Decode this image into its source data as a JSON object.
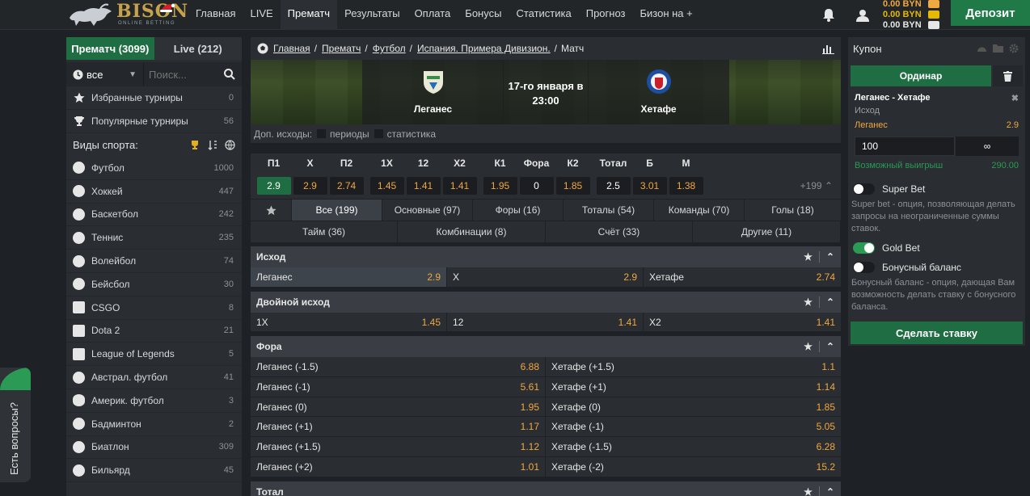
{
  "logo": {
    "word": "BISON",
    "tagline": "ONLINE BETTING"
  },
  "nav": [
    "Главная",
    "LIVE",
    "Прематч",
    "Результаты",
    "Оплата",
    "Бонусы",
    "Статистика",
    "Прогноз",
    "Бизон на +"
  ],
  "nav_active": "Прематч",
  "balances": [
    {
      "amount": "0.00 BYN",
      "color": "#f0a840",
      "icon": "wallet-icon"
    },
    {
      "amount": "0.00 BYN",
      "color": "#e6b800",
      "icon": "bonus-icon"
    },
    {
      "amount": "0.00 BYN",
      "color": "#e6e6e6",
      "icon": "gift-icon"
    }
  ],
  "deposit_label": "Депозит",
  "sidebar": {
    "tab_prematch": "Прематч (3099)",
    "tab_live": "Live (212)",
    "filter_value": "все",
    "search_placeholder": "Поиск...",
    "favorites": {
      "label": "Избранные турниры",
      "count": "0"
    },
    "popular": {
      "label": "Популярные турниры",
      "count": "56"
    },
    "sports_title": "Виды спорта:",
    "sports": [
      {
        "label": "Футбол",
        "count": "1000",
        "icon": "soccer-icon"
      },
      {
        "label": "Хоккей",
        "count": "447",
        "icon": "hockey-icon"
      },
      {
        "label": "Баскетбол",
        "count": "242",
        "icon": "basketball-icon"
      },
      {
        "label": "Теннис",
        "count": "235",
        "icon": "tennis-icon"
      },
      {
        "label": "Волейбол",
        "count": "74",
        "icon": "volleyball-icon"
      },
      {
        "label": "Бейсбол",
        "count": "30",
        "icon": "baseball-icon"
      },
      {
        "label": "CSGO",
        "count": "8",
        "icon": "csgo-icon"
      },
      {
        "label": "Dota 2",
        "count": "21",
        "icon": "dota-icon"
      },
      {
        "label": "League of Legends",
        "count": "5",
        "icon": "lol-icon"
      },
      {
        "label": "Австрал. футбол",
        "count": "41",
        "icon": "aussie-rules-icon"
      },
      {
        "label": "Америк. футбол",
        "count": "3",
        "icon": "american-football-icon"
      },
      {
        "label": "Бадминтон",
        "count": "2",
        "icon": "badminton-icon"
      },
      {
        "label": "Биатлон",
        "count": "309",
        "icon": "biathlon-icon"
      },
      {
        "label": "Бильярд",
        "count": "45",
        "icon": "billiards-icon"
      }
    ]
  },
  "chat_label": "Есть вопросы?",
  "breadcrumb": {
    "items": [
      "Главная",
      "Прематч",
      "Футбол",
      "Испания. Примера Дивизион."
    ],
    "current": "Матч"
  },
  "match": {
    "home": "Леганес",
    "away": "Хетафе",
    "date": "17-го января в",
    "time": "23:00"
  },
  "extra": {
    "label": "Доп. исходы:",
    "opt1": "периоды",
    "opt2": "статистика"
  },
  "quick": {
    "headers": [
      "П1",
      "X",
      "П2",
      "1X",
      "12",
      "X2",
      "К1",
      "Фора",
      "К2",
      "Тотал",
      "Б",
      "М"
    ],
    "values": [
      "2.9",
      "2.9",
      "2.74",
      "1.45",
      "1.41",
      "1.41",
      "1.95",
      "0",
      "1.85",
      "2.5",
      "3.01",
      "1.38"
    ],
    "more": "+199"
  },
  "tabs_row1": [
    "Все (199)",
    "Основные (97)",
    "Форы (16)",
    "Тоталы (54)",
    "Команды (70)",
    "Голы (18)"
  ],
  "tabs_row2": [
    "Тайм (36)",
    "Комбинации (8)",
    "Счёт (33)",
    "Другие (11)"
  ],
  "markets": {
    "outcome": {
      "title": "Исход",
      "cells": [
        {
          "label": "Леганес",
          "odd": "2.9"
        },
        {
          "label": "X",
          "odd": "2.9"
        },
        {
          "label": "Хетафе",
          "odd": "2.74"
        }
      ]
    },
    "double": {
      "title": "Двойной исход",
      "cells": [
        {
          "label": "1X",
          "odd": "1.45"
        },
        {
          "label": "12",
          "odd": "1.41"
        },
        {
          "label": "X2",
          "odd": "1.41"
        }
      ]
    },
    "handicap": {
      "title": "Фора",
      "rows": [
        [
          {
            "label": "Леганес (-1.5)",
            "odd": "6.88"
          },
          {
            "label": "Хетафе (+1.5)",
            "odd": "1.1"
          }
        ],
        [
          {
            "label": "Леганес (-1)",
            "odd": "5.61"
          },
          {
            "label": "Хетафе (+1)",
            "odd": "1.14"
          }
        ],
        [
          {
            "label": "Леганес (0)",
            "odd": "1.95"
          },
          {
            "label": "Хетафе (0)",
            "odd": "1.85"
          }
        ],
        [
          {
            "label": "Леганес (+1)",
            "odd": "1.17"
          },
          {
            "label": "Хетафе (-1)",
            "odd": "5.05"
          }
        ],
        [
          {
            "label": "Леганес (+1.5)",
            "odd": "1.12"
          },
          {
            "label": "Хетафе (-1.5)",
            "odd": "6.28"
          }
        ],
        [
          {
            "label": "Леганес (+2)",
            "odd": "1.01"
          },
          {
            "label": "Хетафе (-2)",
            "odd": "15.2"
          }
        ]
      ]
    },
    "total": {
      "title": "Тотал"
    }
  },
  "coupon": {
    "title": "Купон",
    "type": "Ординар",
    "bet_match": "Леганес - Хетафе",
    "bet_market": "Исход",
    "bet_pick": "Леганес",
    "bet_odd": "2.9",
    "stake": "100",
    "max": "∞",
    "win_label": "Возможный выигрыш",
    "win_value": "290.00",
    "superbet_label": "Super Bet",
    "superbet_desc": "Super bet - опция, позволяющая делать запросы на неограниченные суммы ставок.",
    "goldbet_label": "Gold Bet",
    "bonus_label": "Бонусный баланс",
    "bonus_desc": "Бонусный баланс - опция, дающая Вам возможность делать ставку с бонусного баланса.",
    "place_label": "Сделать ставку"
  },
  "colors": {
    "accent": "#1f6e43",
    "odd": "#f0a840",
    "green_text": "#2b9a55"
  }
}
